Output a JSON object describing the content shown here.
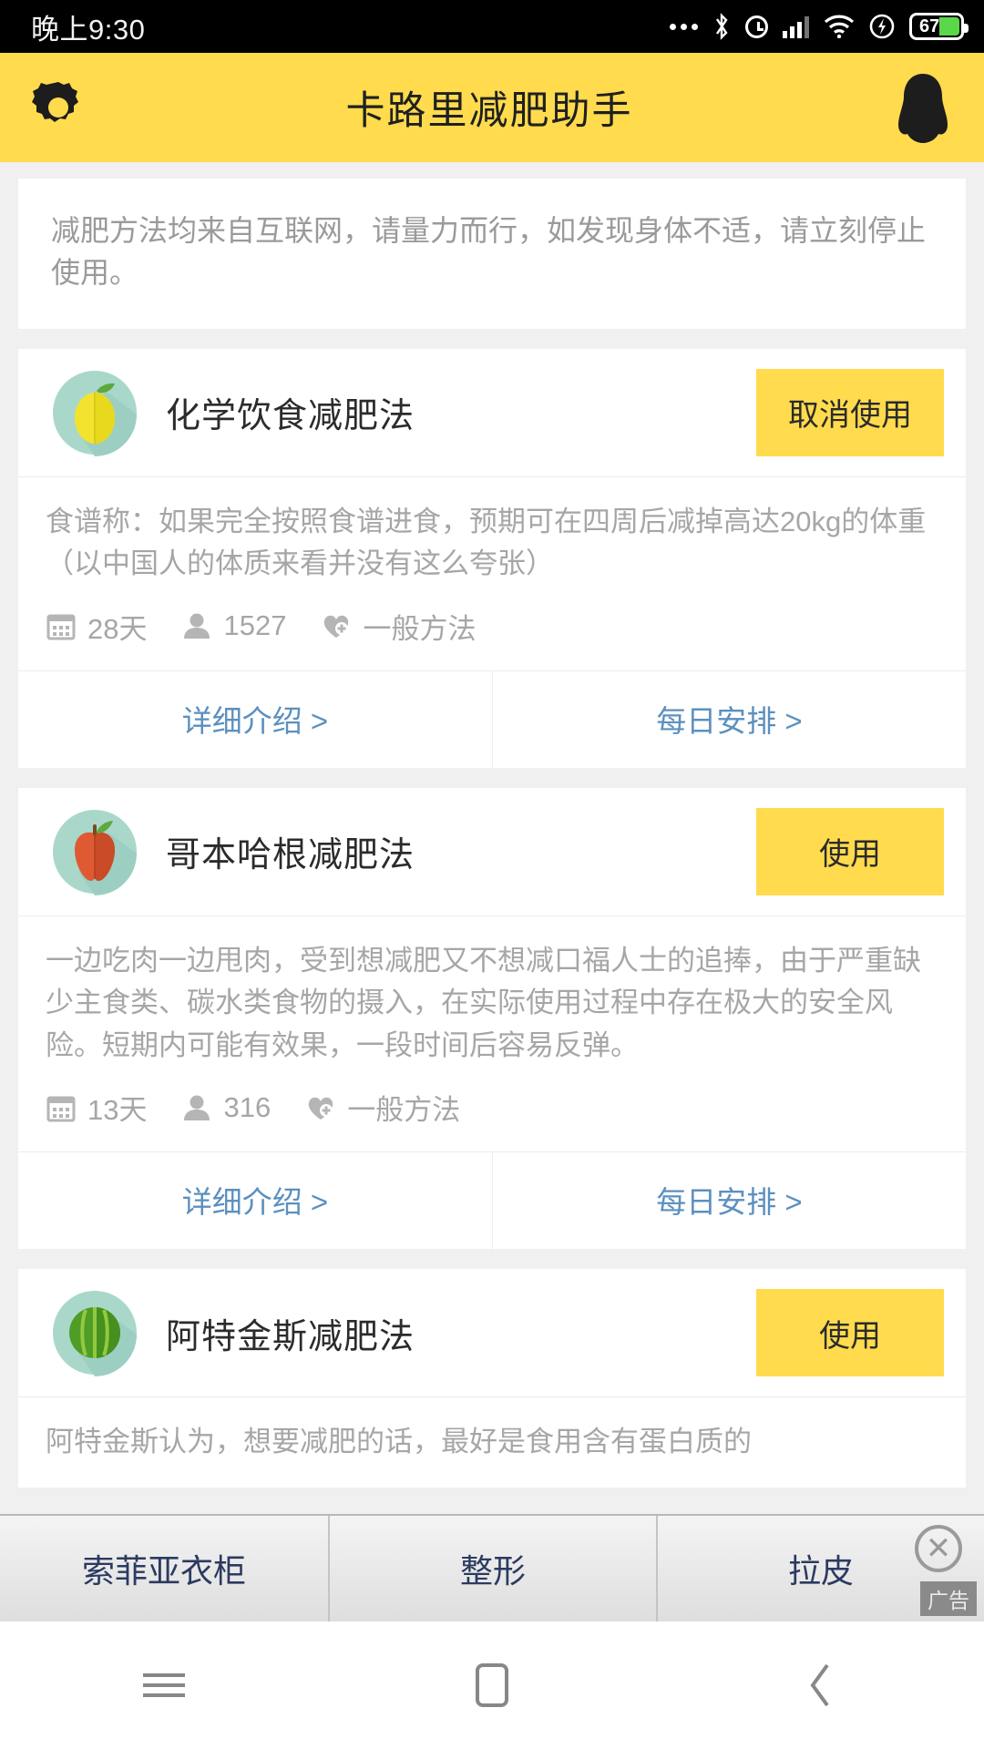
{
  "status_bar": {
    "time": "晚上9:30",
    "battery_percent": "67",
    "icons": [
      "more-dots-icon",
      "bluetooth-icon",
      "alarm-icon",
      "signal-icon",
      "wifi-icon",
      "flash-icon",
      "battery-icon"
    ]
  },
  "header": {
    "title": "卡路里减肥助手",
    "left_icon": "gear-icon",
    "right_icon": "qq-penguin-icon"
  },
  "notice": {
    "text": "减肥方法均来自互联网，请量力而行，如发现身体不适，请立刻停止使用。"
  },
  "meta_labels": {
    "days_icon": "calendar-icon",
    "users_icon": "person-icon",
    "type_icon": "heart-plus-icon"
  },
  "footer_links": {
    "detail": "详细介绍 >",
    "schedule": "每日安排 >"
  },
  "plans": [
    {
      "icon": "lemon-icon",
      "title": "化学饮食减肥法",
      "button": "取消使用",
      "button_state": "in-use",
      "description": "食谱称：如果完全按照食谱进食，预期可在四周后减掉高达20kg的体重（以中国人的体质来看并没有这么夸张）",
      "days": "28天",
      "users": "1527",
      "type": "一般方法"
    },
    {
      "icon": "apple-icon",
      "title": "哥本哈根减肥法",
      "button": "使用",
      "button_state": "available",
      "description": "一边吃肉一边甩肉，受到想减肥又不想减口福人士的追捧，由于严重缺少主食类、碳水类食物的摄入，在实际使用过程中存在极大的安全风险。短期内可能有效果，一段时间后容易反弹。",
      "days": "13天",
      "users": "316",
      "type": "一般方法"
    },
    {
      "icon": "watermelon-icon",
      "title": "阿特金斯减肥法",
      "button": "使用",
      "button_state": "available",
      "description": "阿特金斯认为，想要减肥的话，最好是食用含有蛋白质的"
    }
  ],
  "ad": {
    "cells": [
      "索菲亚衣柜",
      "整形",
      "拉皮"
    ],
    "close_icon": "close-icon",
    "tag": "广告"
  },
  "navbar": {
    "items": [
      "menu-icon",
      "home-icon",
      "back-icon"
    ]
  },
  "colors": {
    "accent_yellow": "#ffdb4d",
    "link_blue": "#5b90bf",
    "page_bg": "#f0f0f0",
    "text_gray": "#a6a6a6"
  }
}
